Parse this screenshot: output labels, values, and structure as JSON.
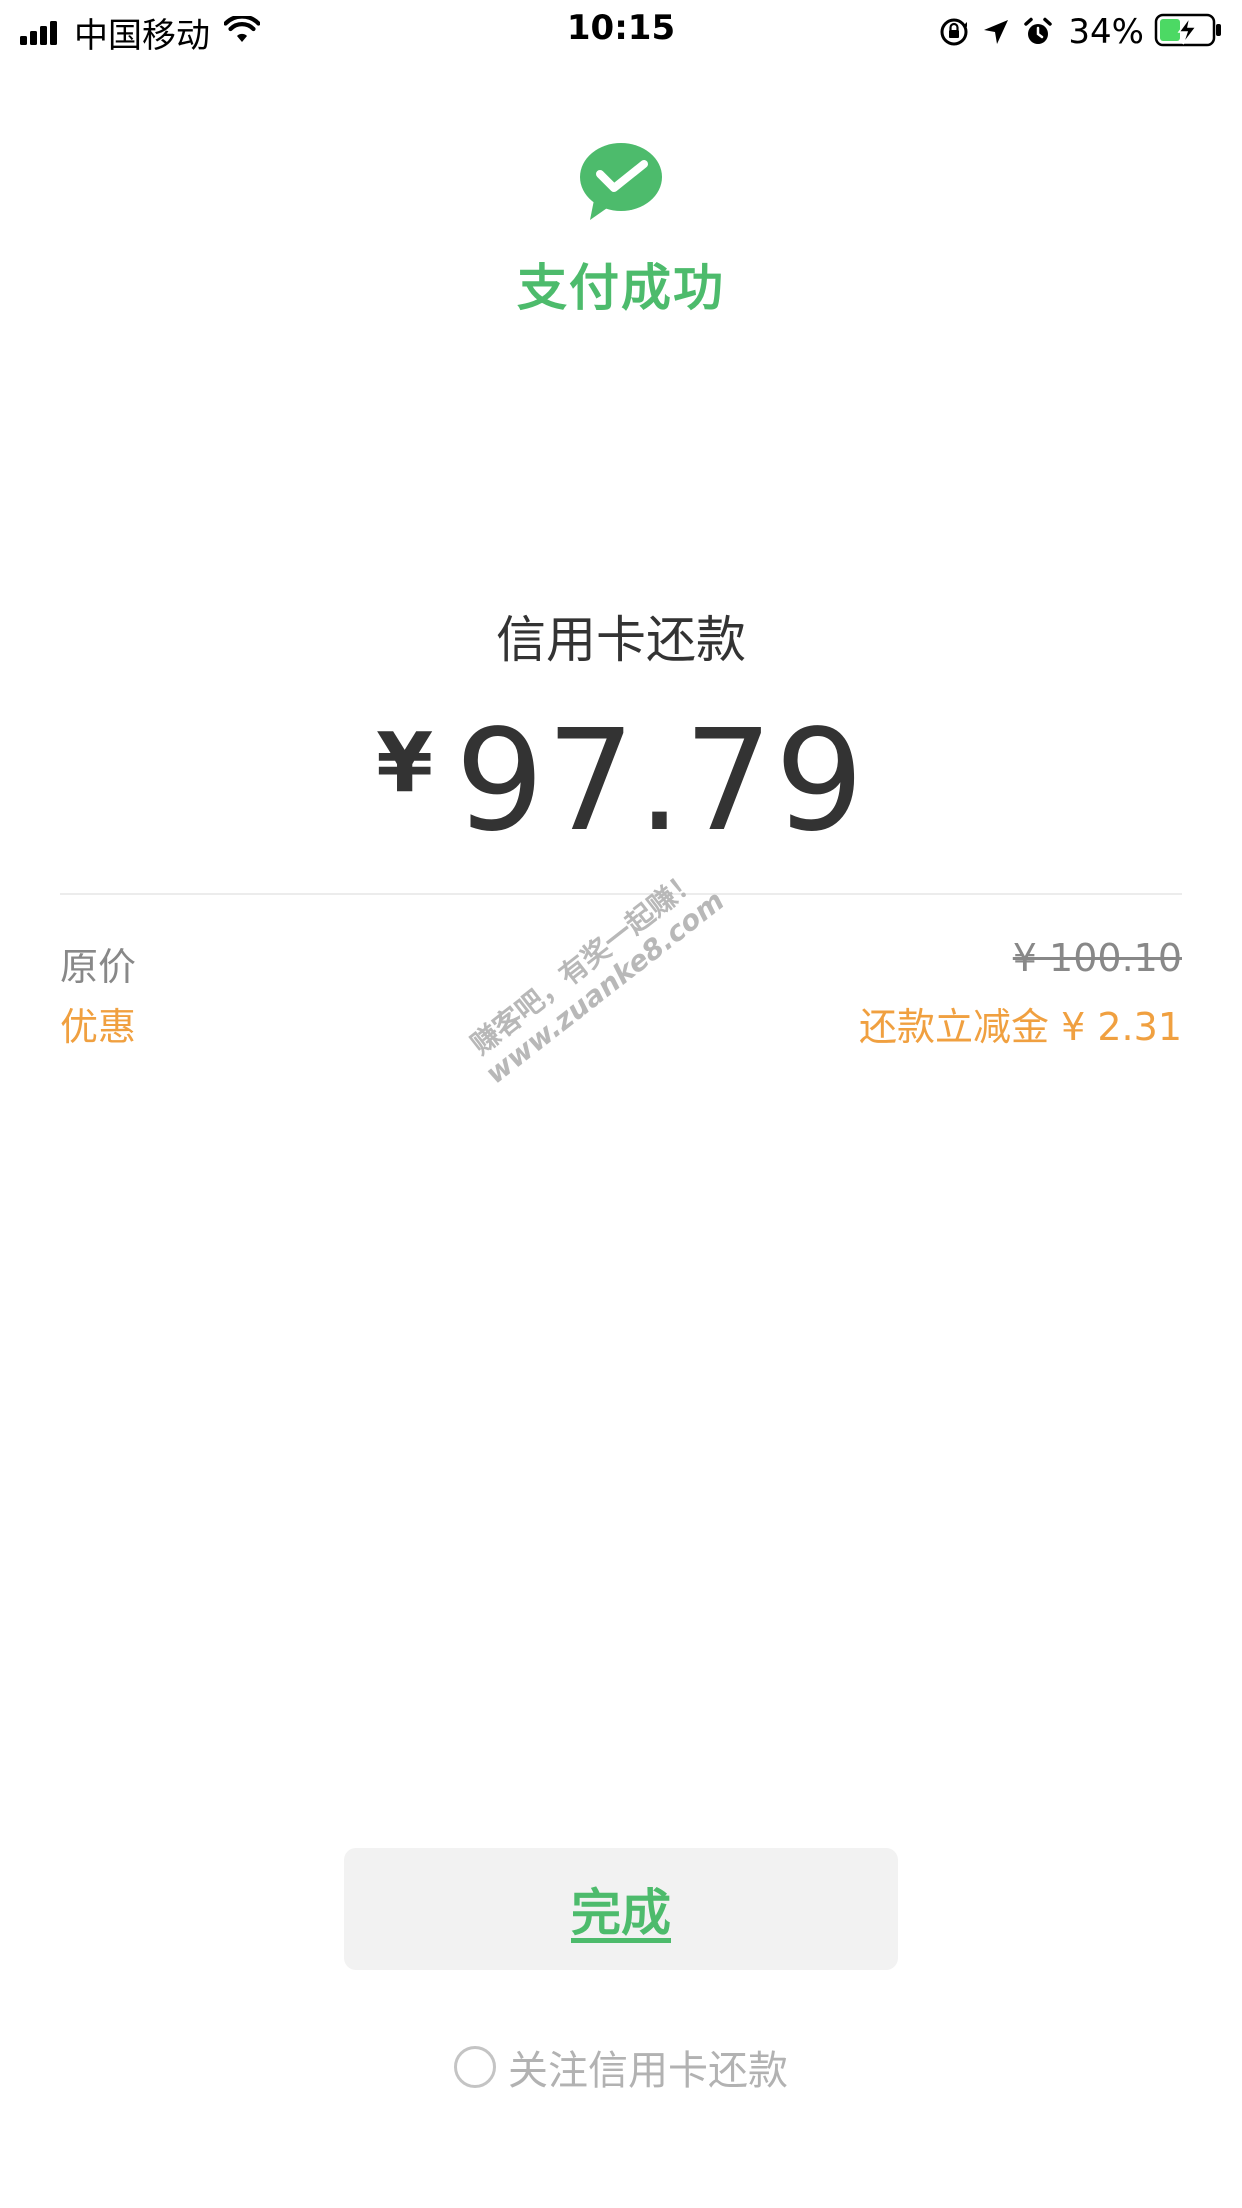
{
  "colors": {
    "accent_green": "#4DBB6C",
    "discount_orange": "#F0A040",
    "text_dark": "#333333",
    "text_gray": "#888888",
    "divider": "#ECECEC",
    "button_bg": "#F2F2F2"
  },
  "status_bar": {
    "carrier": "中国移动",
    "time": "10:15",
    "battery_percent": "34%",
    "signal_bars": 4,
    "icons": [
      "signal-icon",
      "wifi-icon",
      "orientation-lock-icon",
      "location-arrow-icon",
      "alarm-icon",
      "battery-charging-icon"
    ]
  },
  "header": {
    "logo_icon": "wechat-pay-check-icon",
    "title": "支付成功"
  },
  "payment": {
    "merchant": "信用卡还款",
    "currency_symbol": "¥",
    "amount": "97.79"
  },
  "details": {
    "original_label": "原价",
    "original_value": "¥ 100.10",
    "discount_label": "优惠",
    "discount_value": "还款立减金 ¥ 2.31"
  },
  "watermark": {
    "line1": "赚客吧，有奖一起赚！",
    "line2": "www.zuanke8.com"
  },
  "actions": {
    "done_label": "完成",
    "follow_label": "关注信用卡还款",
    "follow_checked": false
  }
}
